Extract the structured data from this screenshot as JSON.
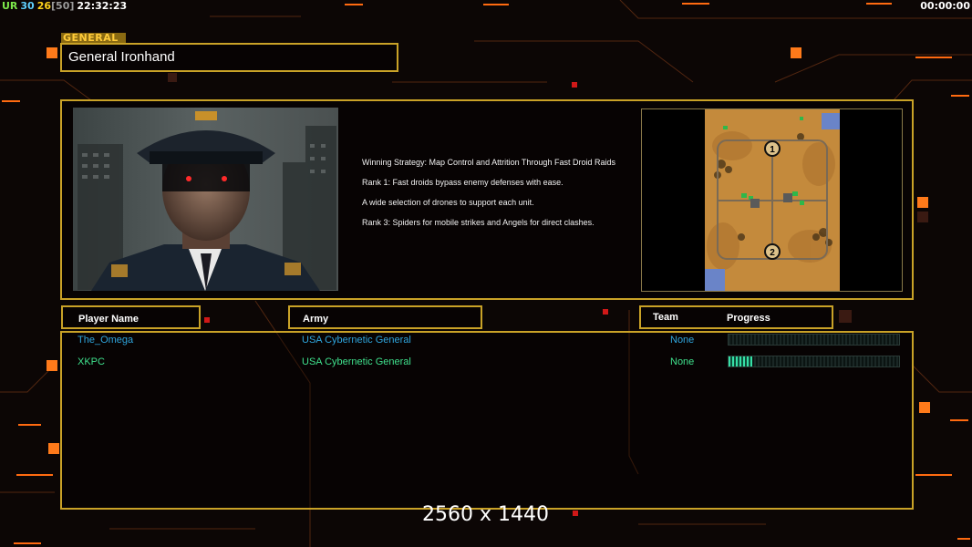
{
  "hud": {
    "ur": "UR",
    "stat1": "30",
    "stat2": "26",
    "stat3": "[50]",
    "clock": "22:32:23",
    "timer": "00:00:00"
  },
  "general": {
    "tag": "GENERAL",
    "name": "General Ironhand"
  },
  "strategy": [
    "Winning Strategy: Map Control and Attrition Through Fast Droid Raids",
    "Rank 1: Fast droids bypass enemy defenses with ease.",
    "A wide selection of drones to support each unit.",
    "Rank 3: Spiders for mobile strikes and Angels for direct clashes."
  ],
  "map": {
    "marker1": "1",
    "marker2": "2"
  },
  "columns": {
    "player": "Player Name",
    "army": "Army",
    "team": "Team",
    "progress": "Progress"
  },
  "players": [
    {
      "name": "The_Omega",
      "army": "USA Cybernetic General",
      "team": "None",
      "progress": 0.0,
      "color": "#2fa6de"
    },
    {
      "name": "XKPC",
      "army": "USA Cybernetic General",
      "team": "None",
      "progress": 0.14,
      "color": "#3fe08c"
    }
  ],
  "overlay": {
    "resolution": "2560 x 1440"
  },
  "colors": {
    "frame": "#c9a227",
    "accent": "#ff7a1a"
  }
}
